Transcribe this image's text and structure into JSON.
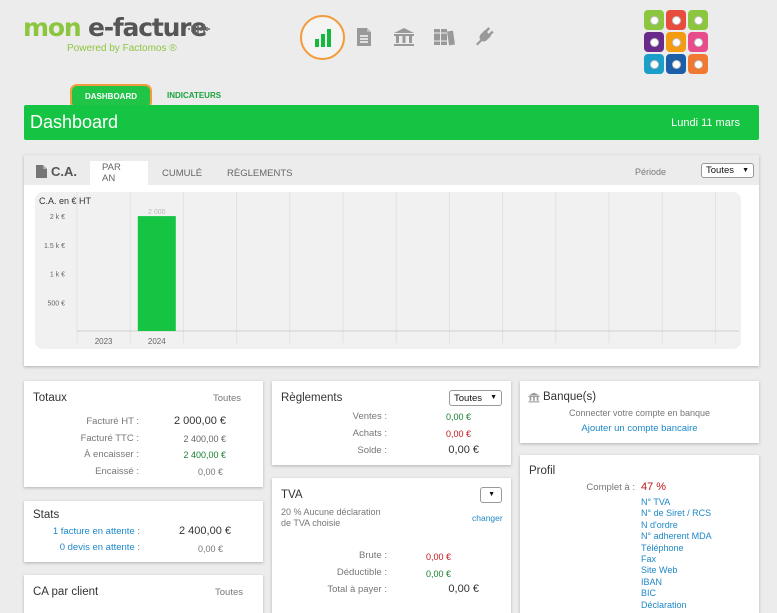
{
  "logo": {
    "part1": "mon ",
    "part2": "e-facture",
    "subtitle": "Powered by Factomos ®"
  },
  "nav": {
    "icons": [
      "chart-bar-icon",
      "document-icon",
      "bank-icon",
      "books-icon",
      "plug-icon"
    ],
    "tabs": [
      {
        "label": "DASHBOARD"
      },
      {
        "label": "INDICATEURS"
      }
    ]
  },
  "app_grid_colors": [
    "#8cc63f",
    "#e74c3c",
    "#8cc63f",
    "#6a2c8a",
    "#f39c12",
    "#e84c8b",
    "#1aa0c8",
    "#1a5fa8",
    "#f07830"
  ],
  "banner": {
    "title": "Dashboard",
    "date": "Lundi 11 mars",
    "color": "#16c443"
  },
  "ca": {
    "title": "C.A.",
    "tabs": [
      "PAR AN",
      "CUMULÉ",
      "RÈGLEMENTS"
    ],
    "periode_label": "Période",
    "periode_value": "Toutes"
  },
  "chart_data": {
    "type": "bar",
    "ylabel": "C.A. en € HT",
    "categories": [
      "2023",
      "2024"
    ],
    "values": [
      0,
      2000
    ],
    "data_labels": [
      "",
      "2 000"
    ],
    "yticks": [
      500,
      1000,
      1500,
      2000
    ],
    "ytick_labels": [
      "500 €",
      "1 k €",
      "1.5 k €",
      "2 k €"
    ],
    "ylim": [
      0,
      2350
    ],
    "bar_color": "#16c443",
    "grid": true
  },
  "totaux": {
    "title": "Totaux",
    "filter": "Toutes",
    "rows": [
      {
        "label": "Facturé HT :",
        "value": "2 000,00 €"
      },
      {
        "label": "Facturé TTC :",
        "value": "2 400,00 €"
      },
      {
        "label": "À encaisser :",
        "value": "2 400,00 €"
      },
      {
        "label": "Encaissé :",
        "value": "0,00 €"
      }
    ]
  },
  "stats": {
    "title": "Stats",
    "rows": [
      {
        "count": "1",
        "link": "facture en attente",
        "sep": " :",
        "value": "2 400,00 €"
      },
      {
        "count": "0",
        "link": "devis en attente",
        "sep": " :",
        "value": "0,00 €"
      }
    ]
  },
  "ca_client": {
    "title": "CA par client",
    "filter": "Toutes"
  },
  "reglements": {
    "title": "Règlements",
    "filter": "Toutes",
    "rows": [
      {
        "label": "Ventes :",
        "value": "0,00 €"
      },
      {
        "label": "Achats :",
        "value": "0,00 €"
      },
      {
        "label": "Solde :",
        "value": "0,00 €"
      }
    ]
  },
  "tva": {
    "title": "TVA",
    "desc_line1": "20 % Aucune déclaration",
    "desc_line2": "de TVA choisie",
    "change": "changer",
    "rows": [
      {
        "label": "Brute :",
        "value": "0,00 €"
      },
      {
        "label": "Déductible :",
        "value": "0,00 €"
      },
      {
        "label": "Total à payer :",
        "value": "0,00 €"
      }
    ]
  },
  "banque": {
    "title": "Banque(s)",
    "text": "Connecter votre compte en banque",
    "link": "Ajouter un compte bancaire"
  },
  "profil": {
    "title": "Profil",
    "complete_label": "Complet à :",
    "complete_value": "47 %",
    "items": [
      "N° TVA",
      "N° de Siret / RCS",
      "N d'ordre",
      "N° adherent MDA",
      "Téléphone",
      "Fax",
      "Site Web",
      "IBAN",
      "BIC",
      "Déclaration"
    ]
  }
}
